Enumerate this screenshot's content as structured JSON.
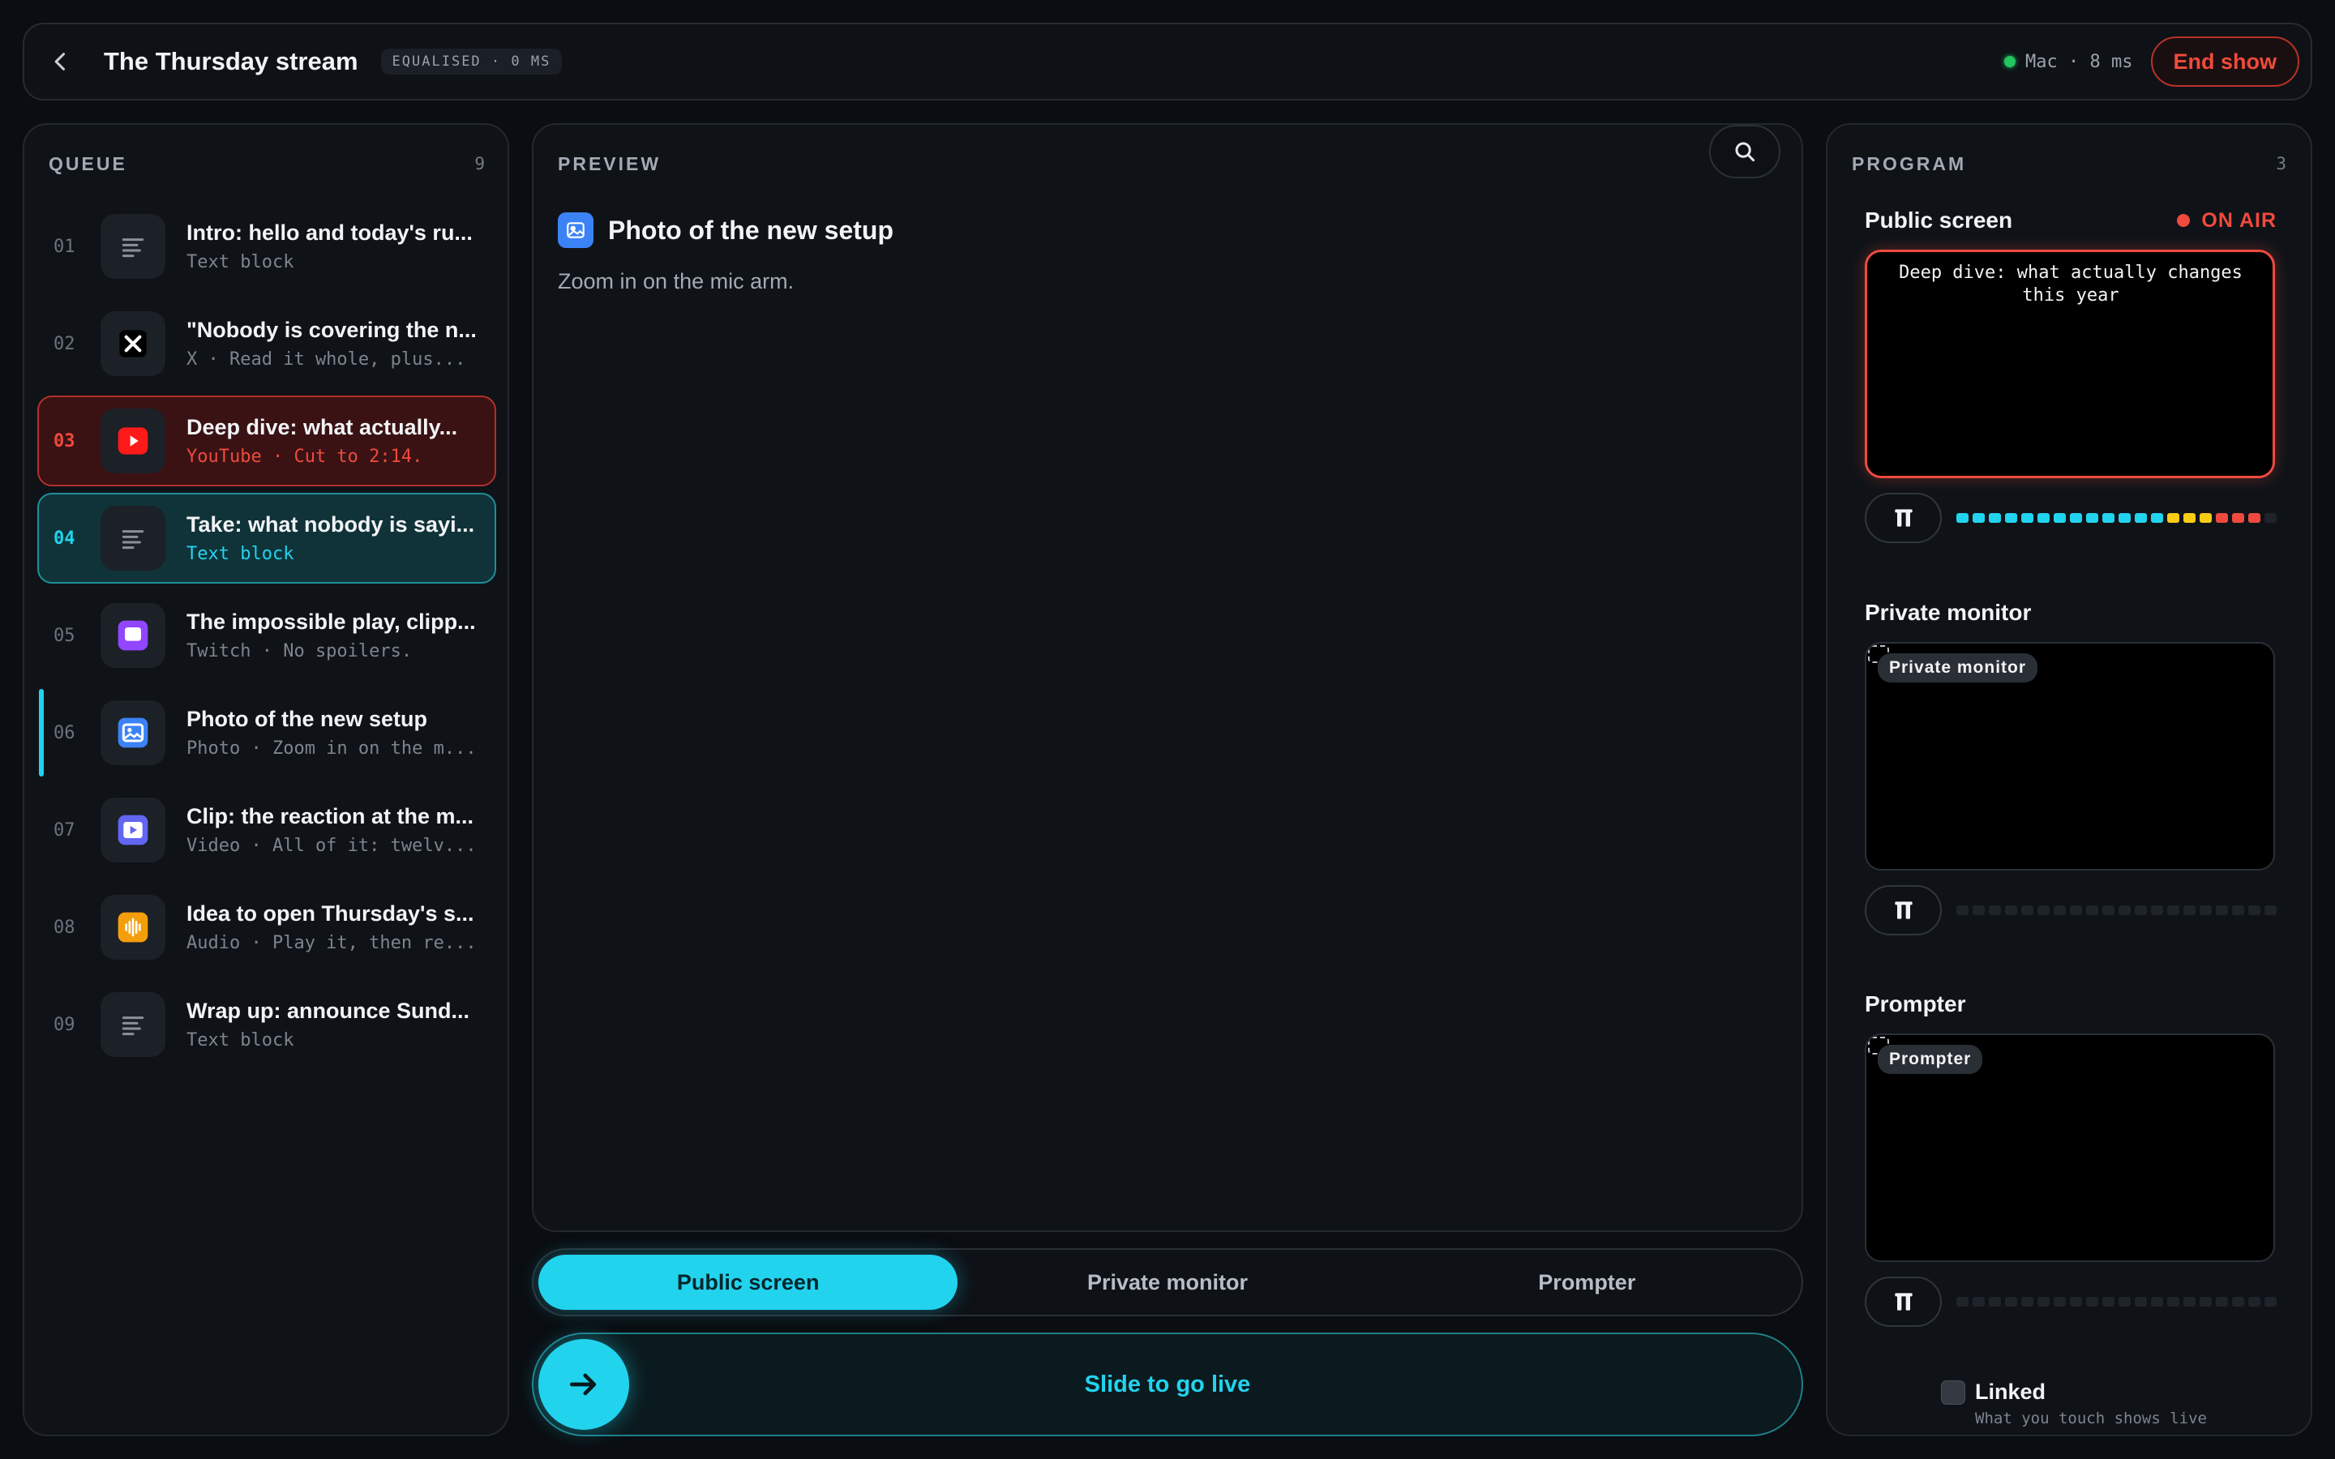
{
  "header": {
    "title": "The Thursday stream",
    "badge": "EQUALISED · 0 MS",
    "connection": "Mac · 8 ms",
    "end_label": "End show"
  },
  "queue": {
    "title": "QUEUE",
    "count": "9",
    "items": [
      {
        "num": "01",
        "title": "Intro: hello and today's ru...",
        "sub": "Text block",
        "icon": "text-icon",
        "state": ""
      },
      {
        "num": "02",
        "title": "\"Nobody is covering the n...",
        "sub": "X · Read it whole, plus...",
        "icon": "x-logo-icon",
        "state": ""
      },
      {
        "num": "03",
        "title": "Deep dive: what actually...",
        "sub": "YouTube · Cut to 2:14.",
        "icon": "youtube-icon",
        "state": "live"
      },
      {
        "num": "04",
        "title": "Take: what nobody is sayi...",
        "sub": "Text block",
        "icon": "text-icon",
        "state": "next"
      },
      {
        "num": "05",
        "title": "The impossible play, clipp...",
        "sub": "Twitch · No spoilers.",
        "icon": "twitch-icon",
        "state": ""
      },
      {
        "num": "06",
        "title": "Photo of the new setup",
        "sub": "Photo · Zoom in on the m...",
        "icon": "photo-icon",
        "state": "current"
      },
      {
        "num": "07",
        "title": "Clip: the reaction at the m...",
        "sub": "Video · All of it: twelv...",
        "icon": "video-icon",
        "state": ""
      },
      {
        "num": "08",
        "title": "Idea to open Thursday's s...",
        "sub": "Audio · Play it, then re...",
        "icon": "audio-icon",
        "state": ""
      },
      {
        "num": "09",
        "title": "Wrap up: announce Sund...",
        "sub": "Text block",
        "icon": "text-icon",
        "state": ""
      }
    ]
  },
  "preview": {
    "title": "PREVIEW",
    "item_title": "Photo of the new setup",
    "item_note": "Zoom in on the mic arm."
  },
  "destinations": {
    "tabs": [
      "Public screen",
      "Private monitor",
      "Prompter"
    ],
    "active": "Public screen"
  },
  "slider": {
    "label": "Slide to go live"
  },
  "program": {
    "title": "PROGRAM",
    "count": "3",
    "outputs": [
      {
        "label": "Public screen",
        "on_air": "ON AIR",
        "content": "Deep dive: what actually changes this year",
        "meter_level": 0.94
      },
      {
        "label": "Private monitor",
        "badge": "Private monitor",
        "meter_level": 0
      },
      {
        "label": "Prompter",
        "badge": "Prompter",
        "meter_level": 0
      }
    ],
    "linked_label": "Linked",
    "linked_sub": "What you touch shows live"
  },
  "colors": {
    "accent": "#22d3ee",
    "live": "#ef4a3d",
    "ok": "#22c55e",
    "meter_warn": "#facc15"
  }
}
